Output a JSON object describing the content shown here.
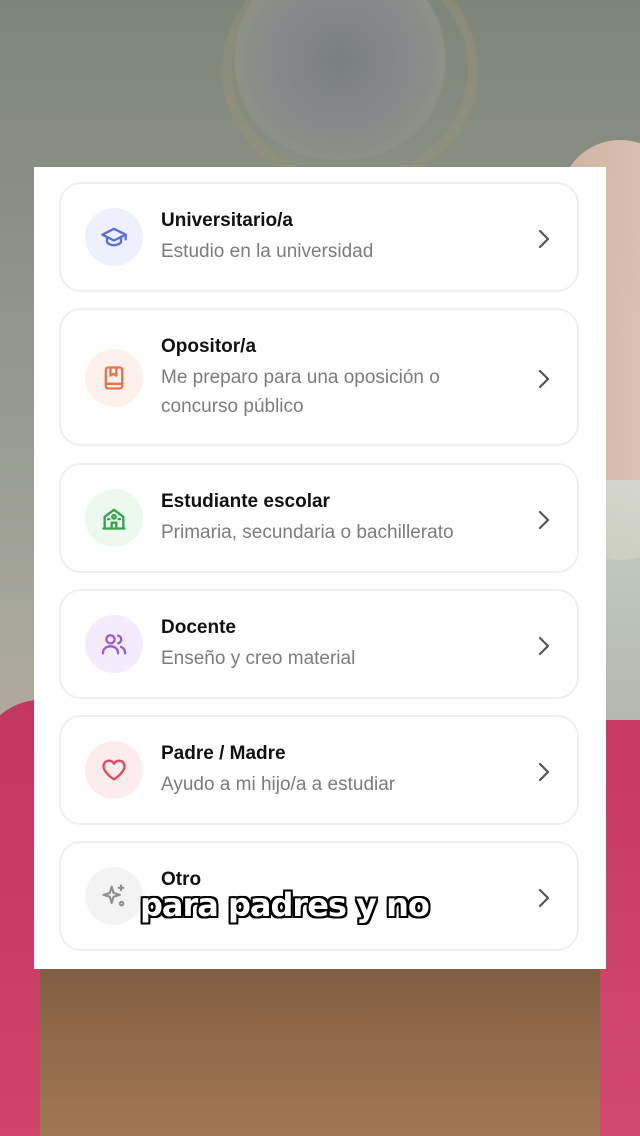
{
  "colors": {
    "university_icon": "#5b6fd6",
    "university_bg": "#eef1fc",
    "opositor_icon": "#e8734a",
    "opositor_bg": "#fdf1ec",
    "escolar_icon": "#35a24d",
    "escolar_bg": "#edf8ef",
    "docente_icon": "#9b59d9",
    "docente_bg": "#f4ecfc",
    "padre_icon": "#e04a5f",
    "padre_bg": "#fcecee",
    "otro_icon": "#8e8e8e",
    "otro_bg": "#f3f3f3"
  },
  "options": [
    {
      "title": "Universitario/a",
      "description": "Estudio en la universidad",
      "icon": "graduation-cap-icon"
    },
    {
      "title": "Opositor/a",
      "description": "Me preparo para una oposición o concurso público",
      "icon": "bookmark-book-icon"
    },
    {
      "title": "Estudiante escolar",
      "description": "Primaria, secundaria o bachillerato",
      "icon": "school-building-icon"
    },
    {
      "title": "Docente",
      "description": "Enseño y creo material",
      "icon": "users-icon"
    },
    {
      "title": "Padre / Madre",
      "description": "Ayudo a mi hijo/a a estudiar",
      "icon": "heart-icon"
    },
    {
      "title": "Otro",
      "description": "",
      "icon": "sparkles-icon"
    }
  ],
  "caption": "para padres y no"
}
